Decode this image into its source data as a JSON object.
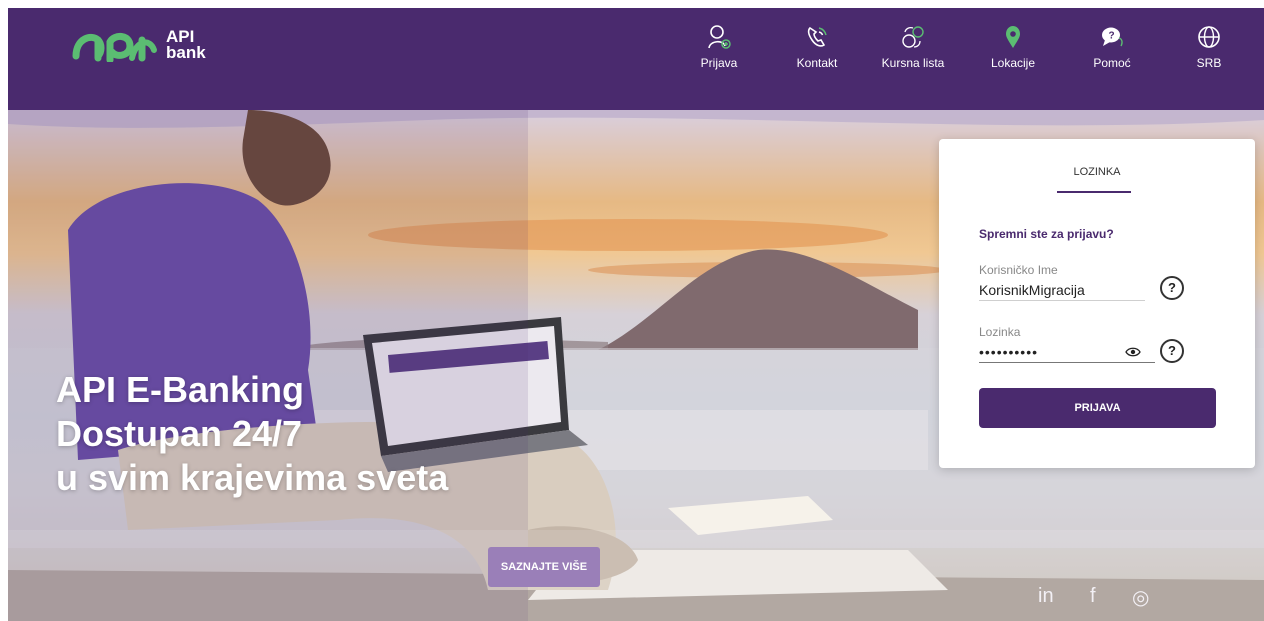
{
  "brand": {
    "logo_text": "API\nbank",
    "accent": "#4a2a6e",
    "green": "#5bbd72"
  },
  "nav": [
    {
      "label": "Prijava",
      "icon": "user-add-icon"
    },
    {
      "label": "Kontakt",
      "icon": "phone-icon"
    },
    {
      "label": "Kursna lista",
      "icon": "currency-exchange-icon"
    },
    {
      "label": "Lokacije",
      "icon": "location-pin-icon"
    },
    {
      "label": "Pomoć",
      "icon": "chat-help-icon"
    },
    {
      "label": "SRB",
      "icon": "globe-icon"
    }
  ],
  "hero": {
    "line1": "API E-Banking",
    "line2": "Dostupan 24/7",
    "line3": "u svim krajevima sveta",
    "cta_label": "SAZNAJTE VIŠE"
  },
  "social": [
    {
      "label": "in",
      "icon": "linkedin-icon"
    },
    {
      "label": "f",
      "icon": "facebook-icon"
    },
    {
      "label": "◎",
      "icon": "instagram-icon"
    }
  ],
  "login": {
    "tab_label": "LOZINKA",
    "heading": "Spremni ste za prijavu?",
    "username_label": "Korisničko Ime",
    "username_value": "KorisnikMigracija",
    "password_label": "Lozinka",
    "password_value": "••••••••••",
    "help_glyph": "?",
    "submit_label": "PRIJAVA"
  }
}
